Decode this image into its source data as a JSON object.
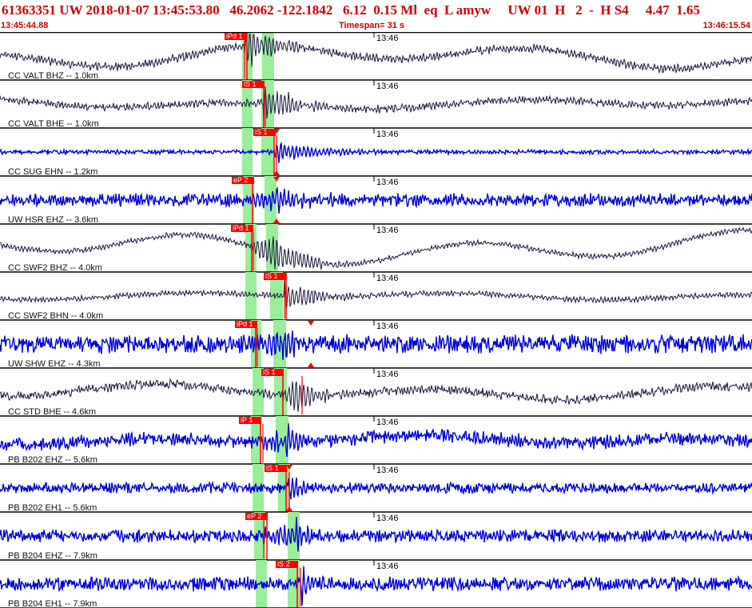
{
  "header": {
    "title": "61363351 UW 2018-01-07 13:45:53.80   46.2062 -122.1842   6.12  0.15 Ml  eq  L amyw     UW 01  H   2  -  H S4     4.47  1.65",
    "start_time": "13:45:44.88",
    "timespan": "Timespan=  31 s",
    "end_time": "13:46:15.54"
  },
  "colors": {
    "header_text": "#cc0000",
    "pick": "#ff0000",
    "window": "#99ee99",
    "trace_black": "#14143c",
    "trace_blue": "#0000dd"
  },
  "minute_label": "13:46",
  "traces": [
    {
      "label": "CC VALT BHZ -- 1.0km",
      "color": "black",
      "pick": "iPd 1",
      "arrow": false
    },
    {
      "label": "CC VALT BHE -- 1.0km",
      "color": "black",
      "pick": "iS 1",
      "arrow": false
    },
    {
      "label": "CC SUG EHN -- 1.2km",
      "color": "blue",
      "pick": "iS 1",
      "arrow": true
    },
    {
      "label": "UW HSR EHZ -- 3.6km",
      "color": "blue",
      "pick": "eP 2",
      "arrow": true
    },
    {
      "label": "CC SWF2 BHZ -- 4.0km",
      "color": "black",
      "pick": "iPd 1",
      "arrow": false
    },
    {
      "label": "CC SWF2 BHN -- 4.0km",
      "color": "black",
      "pick": "iS 1",
      "arrow": false
    },
    {
      "label": "UW SHW EHZ -- 4.3km",
      "color": "blue",
      "pick": "iPd 1",
      "arrow": true
    },
    {
      "label": "CC STD BHE -- 4.6km",
      "color": "black",
      "pick": "iS 1",
      "arrow": false
    },
    {
      "label": "PB B202 EHZ -- 5.6km",
      "color": "blue",
      "pick": "iP 1",
      "arrow": false
    },
    {
      "label": "PB B202 EH1 -- 5.6km",
      "color": "blue",
      "pick": "iS 1",
      "arrow": true
    },
    {
      "label": "PB B204 EHZ -- 7.9km",
      "color": "blue",
      "pick": "eP 2",
      "arrow": false
    },
    {
      "label": "PB B204 EH1 -- 7.9km",
      "color": "blue",
      "pick": "iS 2",
      "arrow": false
    }
  ]
}
